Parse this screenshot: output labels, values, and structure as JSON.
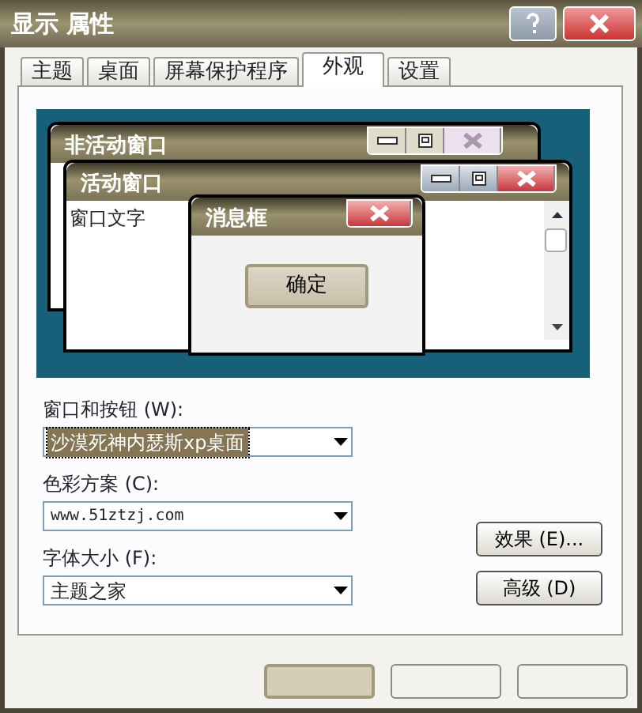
{
  "window": {
    "title": "显示 属性"
  },
  "tabs": [
    {
      "label": "主题",
      "selected": false
    },
    {
      "label": "桌面",
      "selected": false
    },
    {
      "label": "屏幕保护程序",
      "selected": false
    },
    {
      "label": "外观",
      "selected": true
    },
    {
      "label": "设置",
      "selected": false
    }
  ],
  "preview": {
    "inactive_title": "非活动窗口",
    "active_title": "活动窗口",
    "window_text": "窗口文字",
    "message_title": "消息框",
    "message_button": "确定"
  },
  "fields": [
    {
      "label": "窗口和按钮 (W):",
      "value": "沙漠死神内瑟斯xp桌面",
      "selected": true
    },
    {
      "label": "色彩方案 (C):",
      "value": "www.51ztzj.com",
      "selected": false
    },
    {
      "label": "字体大小 (F):",
      "value": "主题之家",
      "selected": false
    }
  ],
  "side_buttons": [
    "效果 (E)...",
    "高级 (D)"
  ],
  "bottom_buttons": [
    {
      "kind": "default"
    },
    {
      "kind": "plain"
    },
    {
      "kind": "plain"
    }
  ]
}
